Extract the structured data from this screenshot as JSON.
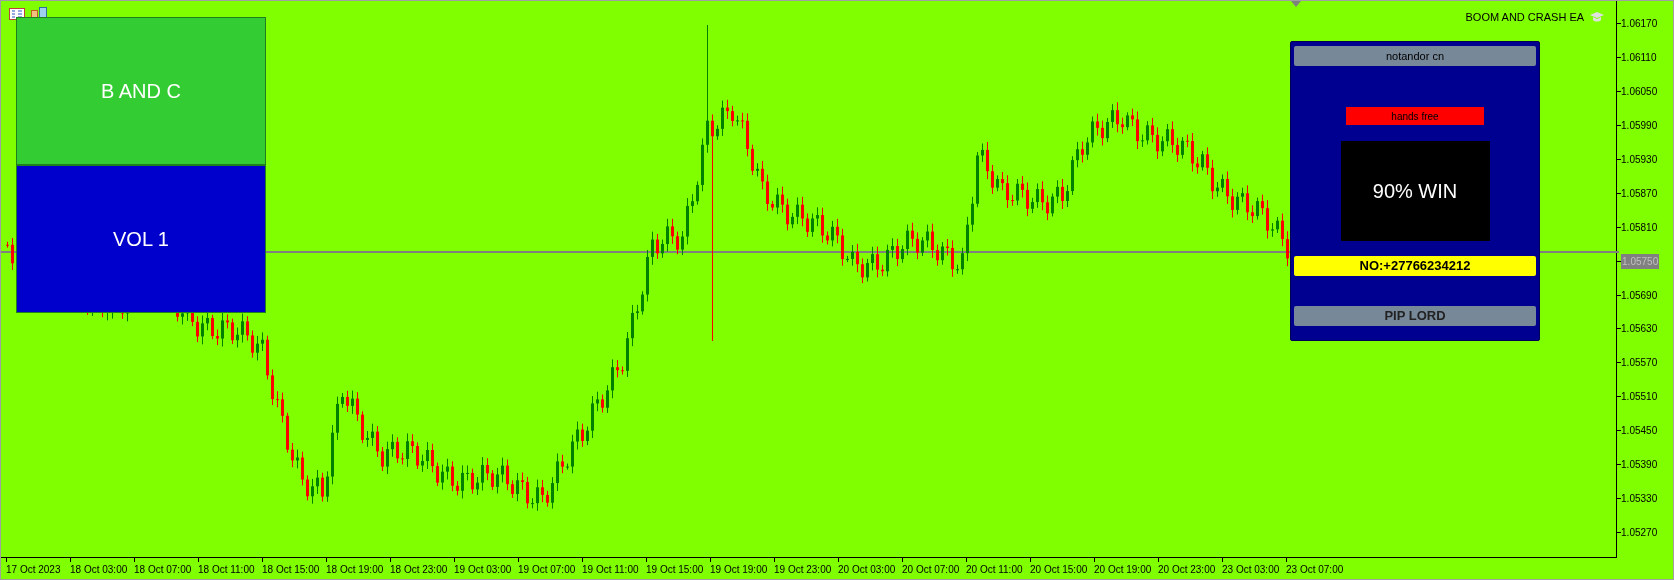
{
  "chart": {
    "indicator_name": "BOOM AND CRASH EA",
    "price_labels": [
      {
        "text": "1.06170",
        "kind": "tick"
      },
      {
        "text": "1.06110",
        "kind": "tick"
      },
      {
        "text": "1.06050",
        "kind": "tick"
      },
      {
        "text": "1.05990",
        "kind": "tick"
      },
      {
        "text": "1.05930",
        "kind": "tick"
      },
      {
        "text": "1.05870",
        "kind": "tick"
      },
      {
        "text": "1.05810",
        "kind": "tick"
      },
      {
        "text": "1.05750",
        "kind": "current"
      },
      {
        "text": "1.05690",
        "kind": "tick"
      },
      {
        "text": "1.05630",
        "kind": "tick"
      },
      {
        "text": "1.05570",
        "kind": "tick"
      },
      {
        "text": "1.05510",
        "kind": "tick"
      },
      {
        "text": "1.05450",
        "kind": "tick"
      },
      {
        "text": "1.05390",
        "kind": "tick"
      },
      {
        "text": "1.05330",
        "kind": "tick"
      },
      {
        "text": "1.05270",
        "kind": "tick"
      }
    ],
    "time_labels": [
      "17 Oct 2023",
      "18 Oct 03:00",
      "18 Oct 07:00",
      "18 Oct 11:00",
      "18 Oct 15:00",
      "18 Oct 19:00",
      "18 Oct 23:00",
      "19 Oct 03:00",
      "19 Oct 07:00",
      "19 Oct 11:00",
      "19 Oct 15:00",
      "19 Oct 19:00",
      "19 Oct 23:00",
      "20 Oct 03:00",
      "20 Oct 07:00",
      "20 Oct 11:00",
      "20 Oct 15:00",
      "20 Oct 19:00",
      "20 Oct 23:00",
      "23 Oct 03:00",
      "23 Oct 07:00"
    ]
  },
  "left_panel": {
    "buttons": [
      {
        "label": "B AND C",
        "color": "#33cc33"
      },
      {
        "label": "VOL 1",
        "color": "#0000cc"
      }
    ]
  },
  "right_panel": {
    "header": "notandor cn",
    "status": "hands free",
    "win_rate": "90% WIN",
    "phone": "NO:+27766234212",
    "footer": "PIP LORD"
  }
}
